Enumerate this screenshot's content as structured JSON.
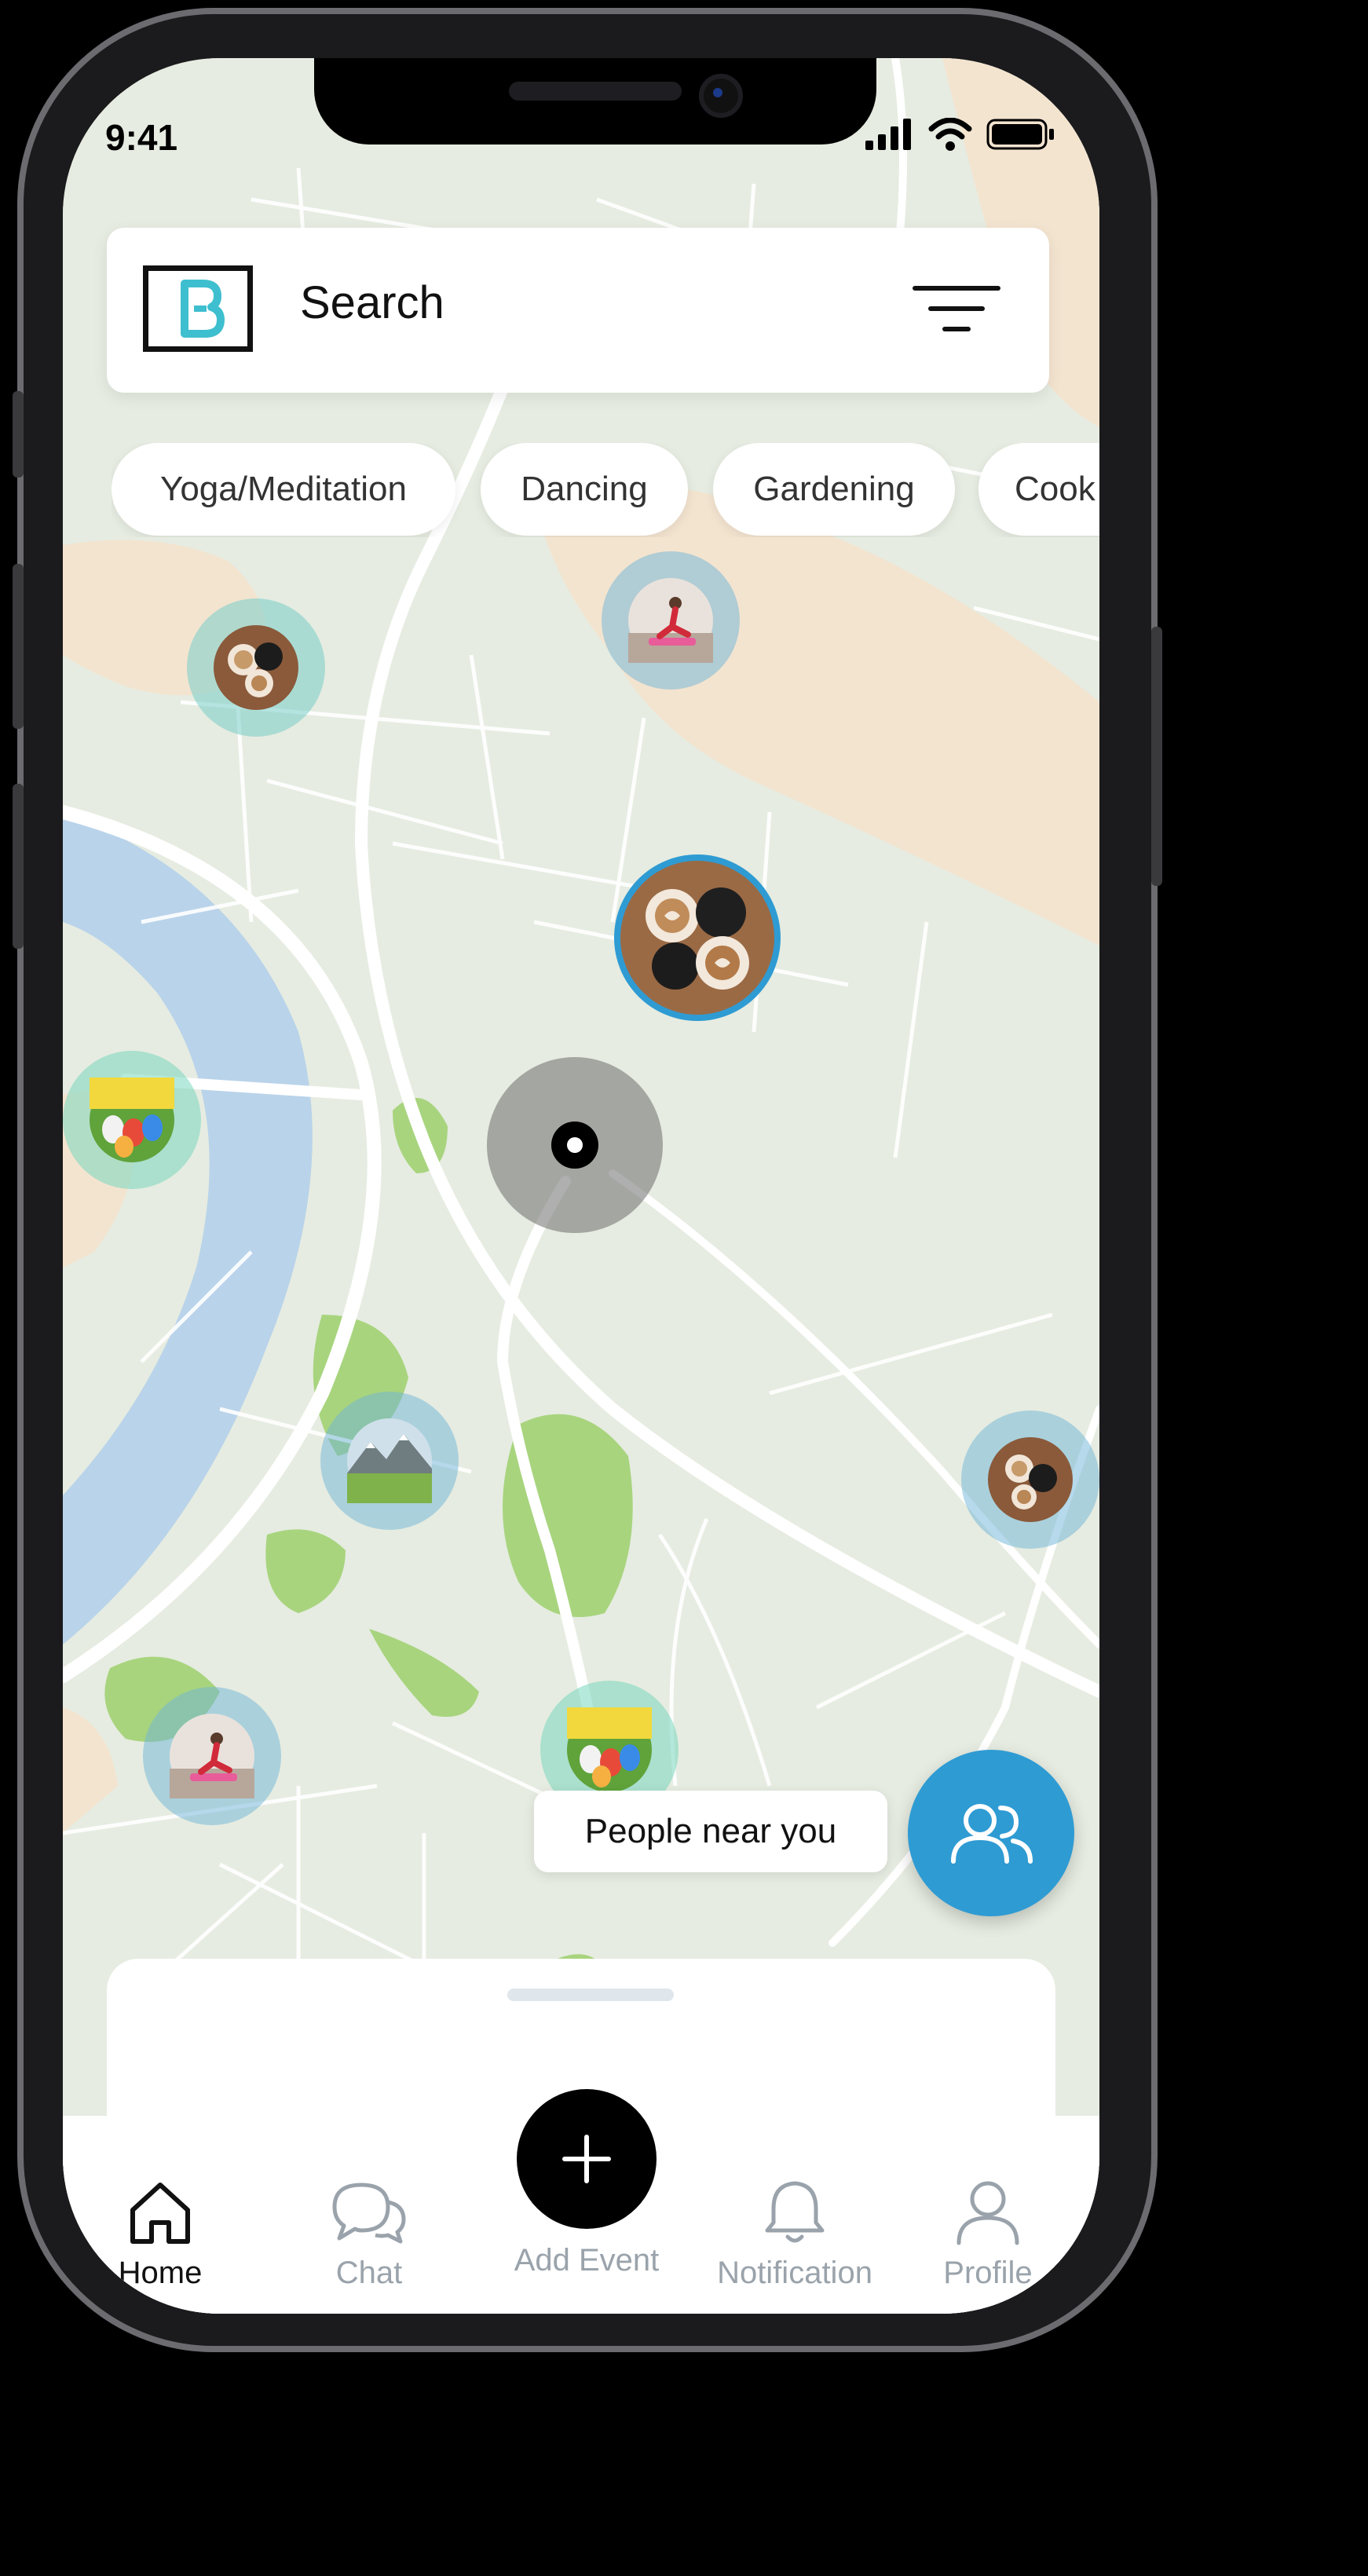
{
  "status_bar": {
    "time": "9:41",
    "icons": [
      "signal-icon",
      "wifi-icon",
      "battery-icon"
    ]
  },
  "search": {
    "logo_icon": "brand-logo",
    "placeholder": "Search",
    "filter_icon": "filter-icon"
  },
  "categories": [
    "Yoga/Meditation",
    "Dancing",
    "Gardening",
    "Cook"
  ],
  "map": {
    "markers": [
      "coffee",
      "yoga",
      "coffee",
      "easter-eggs",
      "mountain",
      "coffee",
      "yoga",
      "easter-eggs"
    ],
    "current_location_icon": "location-dot-icon"
  },
  "people_near": {
    "label": "People near you",
    "icon": "people-icon"
  },
  "tabbar": {
    "items": [
      {
        "label": "Home",
        "icon": "home-icon",
        "active": true
      },
      {
        "label": "Chat",
        "icon": "chat-icon",
        "active": false
      },
      {
        "label": "Add Event",
        "icon": "plus-icon",
        "active": false
      },
      {
        "label": "Notification",
        "icon": "bell-icon",
        "active": false
      },
      {
        "label": "Profile",
        "icon": "profile-icon",
        "active": false
      }
    ]
  },
  "colors": {
    "accent": "#2F9BD3",
    "logo": "#3EBFCF",
    "map_land": "#E6ECE1",
    "water": "#B9D3EA",
    "park": "#A8D47E"
  }
}
